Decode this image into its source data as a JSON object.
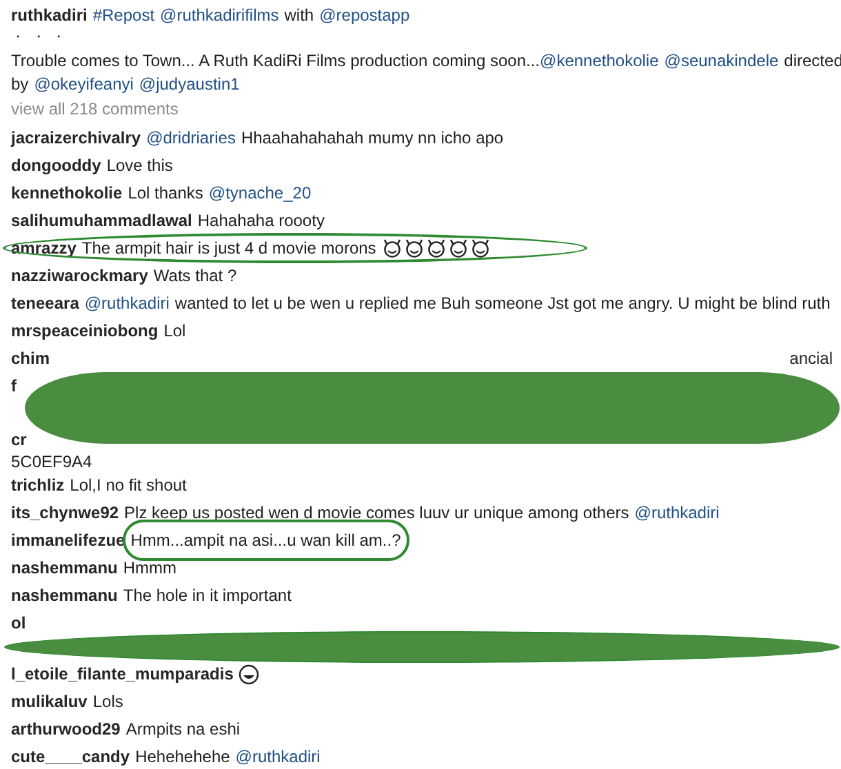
{
  "caption": {
    "user": "ruthkadiri",
    "lines": [
      [
        {
          "kind": "hashtag",
          "text": "#Repost"
        },
        {
          "kind": "mention",
          "text": "@ruthkadirifilms"
        },
        {
          "kind": "text",
          "text": "with"
        },
        {
          "kind": "mention",
          "text": "@repostapp"
        }
      ]
    ],
    "dots": "・ ・ ・",
    "body": [
      [
        {
          "kind": "text",
          "text": "Trouble comes to Town... A Ruth KadiRi Films production coming soon..."
        },
        {
          "kind": "joined_mention",
          "text": "@kennethokolie"
        },
        {
          "kind": "mention",
          "text": "@seunakindele"
        },
        {
          "kind": "text",
          "text": "directed"
        }
      ],
      [
        {
          "kind": "text",
          "text": "by"
        },
        {
          "kind": "mention",
          "text": "@okeyifeanyi"
        },
        {
          "kind": "mention",
          "text": "@judyaustin1"
        }
      ]
    ]
  },
  "view_all": "view all 218 comments",
  "comments": [
    {
      "kind": "comment",
      "user": "jacraizerchivalry",
      "circled": false,
      "parts": [
        {
          "kind": "mention",
          "text": "@dridriaries"
        },
        {
          "kind": "text",
          "text": "Hhaahahahahah mumy nn icho apo"
        }
      ]
    },
    {
      "kind": "comment",
      "user": "dongooddy",
      "circled": false,
      "parts": [
        {
          "kind": "text",
          "text": "Love this"
        }
      ]
    },
    {
      "kind": "comment",
      "user": "kennethokolie",
      "circled": false,
      "parts": [
        {
          "kind": "text",
          "text": "Lol thanks"
        },
        {
          "kind": "mention",
          "text": "@tynache_20"
        }
      ]
    },
    {
      "kind": "comment",
      "user": "salihumuhammadlawal",
      "circled": false,
      "parts": [
        {
          "kind": "text",
          "text": "Hahahaha roooty"
        }
      ]
    },
    {
      "kind": "comment",
      "user": "amrazzy",
      "circled": true,
      "parts": [
        {
          "kind": "text",
          "text": "The armpit hair is just 4 d movie morons"
        }
      ],
      "icons": [
        {
          "kind": "devil"
        },
        {
          "kind": "devil"
        },
        {
          "kind": "devil"
        },
        {
          "kind": "devil"
        },
        {
          "kind": "devil"
        }
      ]
    },
    {
      "kind": "comment",
      "user": "nazziwarockmary",
      "circled": false,
      "parts": [
        {
          "kind": "text",
          "text": "Wats that ?"
        }
      ]
    },
    {
      "kind": "comment",
      "user": "teneeara",
      "circled": false,
      "parts": [
        {
          "kind": "mention",
          "text": "@ruthkadiri"
        },
        {
          "kind": "text",
          "text": "wanted to let u be wen u replied me Buh someone Jst got me angry. U might be blind ruth"
        }
      ]
    },
    {
      "kind": "comment",
      "user": "mrspeaceiniobong",
      "circled": false,
      "parts": [
        {
          "kind": "text",
          "text": "Lol"
        }
      ]
    },
    {
      "kind": "redacted",
      "lines": [
        {
          "left": "chim",
          "right": "ancial"
        },
        {
          "left": "f"
        },
        {
          "left": "cr"
        }
      ]
    },
    {
      "kind": "plain",
      "text": "5C0EF9A4"
    },
    {
      "kind": "comment",
      "user": "trichliz",
      "circled": false,
      "parts": [
        {
          "kind": "text",
          "text": "Lol,I no fit shout"
        }
      ]
    },
    {
      "kind": "comment",
      "user": "its_chynwe92",
      "circled": false,
      "parts": [
        {
          "kind": "text",
          "text": "Plz keep us posted wen d movie comes luuv ur unique among others"
        },
        {
          "kind": "mention",
          "text": "@ruthkadiri"
        }
      ]
    },
    {
      "kind": "comment",
      "user": "immanelifezue",
      "circled": false,
      "parts": [
        {
          "kind": "text",
          "text": "Hmm...ampit na asi...u wan kill am..?",
          "circled": true
        }
      ]
    },
    {
      "kind": "comment",
      "user": "nashemmanu",
      "circled": false,
      "parts": [
        {
          "kind": "text",
          "text": "Hmmm"
        }
      ]
    },
    {
      "kind": "comment",
      "user": "nashemmanu",
      "circled": false,
      "parts": [
        {
          "kind": "text",
          "text": "The hole in it important"
        }
      ]
    },
    {
      "kind": "redacted",
      "lines": [
        {
          "left": "ol"
        }
      ]
    },
    {
      "kind": "comment",
      "user": "l_etoile_filante_mumparadis",
      "circled": false,
      "icons": [
        {
          "kind": "grin"
        }
      ]
    },
    {
      "kind": "comment",
      "user": "mulikaluv",
      "circled": false,
      "parts": [
        {
          "kind": "text",
          "text": "Lols"
        }
      ]
    },
    {
      "kind": "comment",
      "user": "arthurwood29",
      "circled": false,
      "parts": [
        {
          "kind": "text",
          "text": "Armpits na eshi"
        }
      ]
    },
    {
      "kind": "comment",
      "user": "cute____candy",
      "circled": false,
      "parts": [
        {
          "kind": "text",
          "text": "Hehehehehe"
        },
        {
          "kind": "mention",
          "text": "@ruthkadiri"
        }
      ]
    }
  ]
}
